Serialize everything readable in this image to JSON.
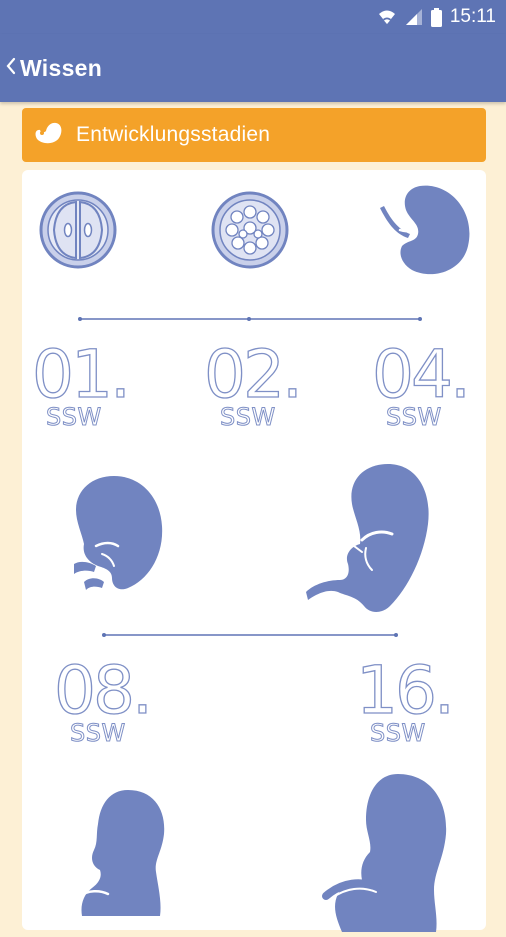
{
  "status_bar": {
    "time": "15:11",
    "icons": [
      "wifi-icon",
      "signal-icon",
      "battery-icon"
    ]
  },
  "app_bar": {
    "back_icon": "chevron-left-icon",
    "title": "Wissen"
  },
  "section": {
    "icon": "embryo-icon",
    "title": "Entwicklungsstadien"
  },
  "stages": [
    {
      "number": "01.",
      "unit": "SSW",
      "icon": "two-cell-icon"
    },
    {
      "number": "02.",
      "unit": "SSW",
      "icon": "morula-icon"
    },
    {
      "number": "04.",
      "unit": "SSW",
      "icon": "embryo-4-week-icon"
    },
    {
      "number": "08.",
      "unit": "SSW",
      "icon": "embryo-8-week-icon"
    },
    {
      "number": "16.",
      "unit": "SSW",
      "icon": "fetus-16-week-icon"
    },
    {
      "number": "",
      "unit": "",
      "icon": "fetus-icon"
    },
    {
      "number": "",
      "unit": "",
      "icon": "fetus-icon"
    }
  ],
  "colors": {
    "primary": "#5e74b4",
    "accent": "#f4a229",
    "background": "#fdf0d5",
    "illustration": "#7184c0"
  }
}
